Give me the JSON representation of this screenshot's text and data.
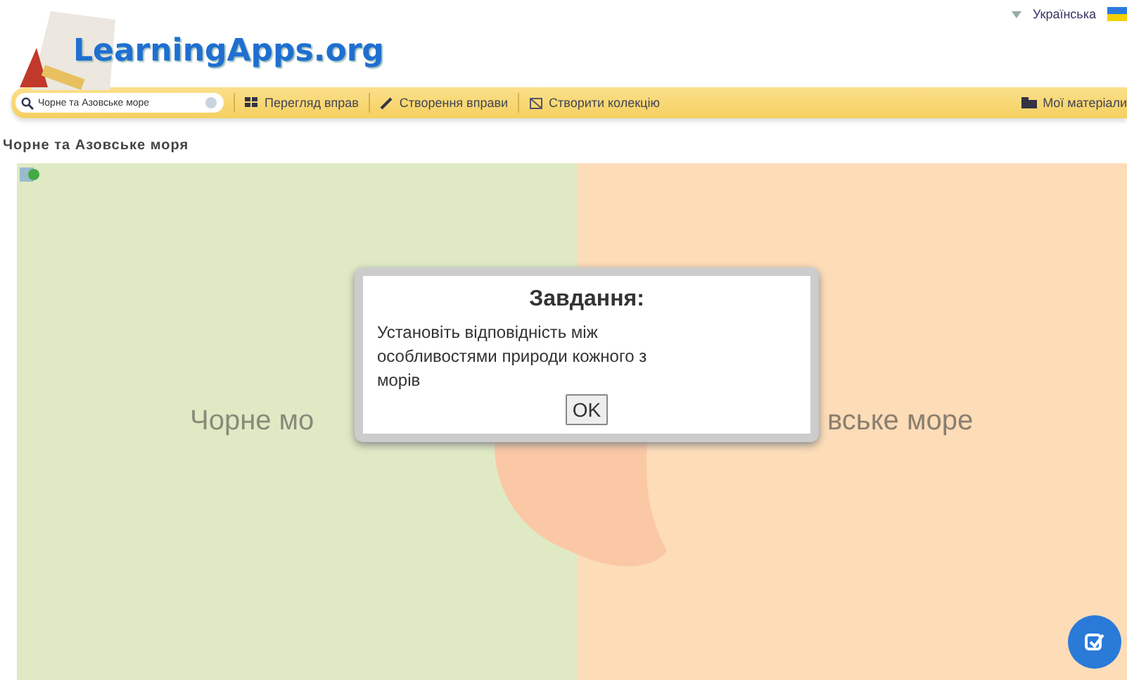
{
  "header": {
    "logo": "LearningApps.org",
    "language": "Українська"
  },
  "toolbar": {
    "search": {
      "value": "Чорне та Азовське море"
    },
    "items": [
      {
        "kind": "browse",
        "label": "Перегляд вправ"
      },
      {
        "kind": "create",
        "label": "Створення вправи"
      },
      {
        "kind": "collection",
        "label": "Створити колекцію"
      }
    ],
    "my_materials": "Мої матеріали"
  },
  "page_title": "Чорне та Азовське моря",
  "game": {
    "left_label": "Чорне мо",
    "right_label": "вське море"
  },
  "dialog": {
    "title": "Завдання:",
    "text": "Установіть відповідність між особливостями природи кожного з морів",
    "button": "OK"
  }
}
